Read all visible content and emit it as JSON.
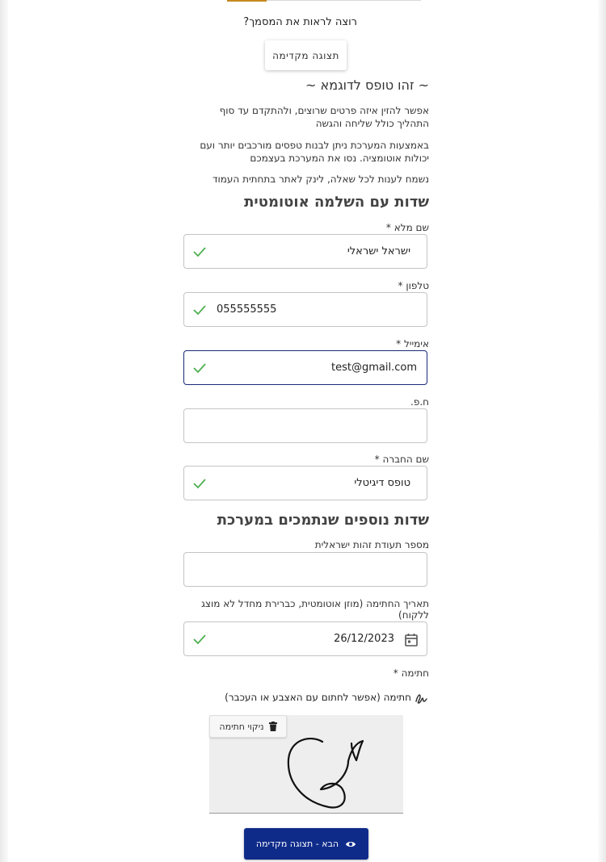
{
  "preview": {
    "question": "רוצה לראות את המסמך?",
    "button_label": "תצוגה מקדימה"
  },
  "demo": {
    "title": "~ זהו טופס לדוגמא ~",
    "paragraphs": [
      "אפשר להזין איזה פרטים שרוצים, ולהתקדם עד סוף התהליך כולל שליחה והגשה",
      "באמצעות המערכת ניתן לבנות טפסים מורכבים יותר ועם יכולות אוטומציה. נסו את המערכת בעצמכם",
      "נשמח לענות לכל שאלה, לינק לאתר בתחתית העמוד"
    ]
  },
  "section1": {
    "title": "שדות עם השלמה אוטומטית",
    "fields": [
      {
        "label": "שם מלא *",
        "value": "ישראל ישראלי"
      },
      {
        "label": "טלפון *",
        "value": "055555555"
      },
      {
        "label": "אימייל *",
        "value": "test@gmail.com"
      },
      {
        "label": "ח.פ.",
        "value": ""
      },
      {
        "label": "שם החברה *",
        "value": "טופס דיגיטלי"
      }
    ]
  },
  "section2": {
    "title": "שדות נוספים שנתמכים במערכת",
    "id_label": "מספר תעודת זהות ישראלית",
    "id_value": "",
    "date_label": "תאריך החתימה (מוזן אוטומטית, כברירת מחדל לא מוצג ללקוח)",
    "date_value": "26/12/2023",
    "signature_label": "חתימה *",
    "signature_hint": "חתימה (אפשר לחתום עם האצבע או העכבר)",
    "clear_label": "ניקוי חתימה"
  },
  "next_button": "הבא - תצוגה מקדימה",
  "colors": {
    "accent": "#0f2b8a",
    "check_green": "#4caf50",
    "tab_gold": "#c58a1e"
  },
  "icons": [
    "check-icon",
    "calendar-icon",
    "signature-icon",
    "trash-icon",
    "eye-icon"
  ]
}
